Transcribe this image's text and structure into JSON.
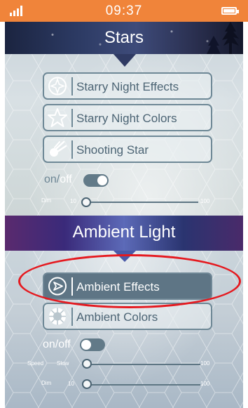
{
  "status_bar": {
    "time": "09:37"
  },
  "stars": {
    "title": "Stars",
    "buttons": [
      {
        "label": "Starry Night Effects",
        "icon": "compass-star-icon"
      },
      {
        "label": "Starry Night Colors",
        "icon": "star-outline-icon"
      },
      {
        "label": "Shooting Star",
        "icon": "shooting-star-icon"
      }
    ],
    "toggle": {
      "on": "on",
      "slash": "/",
      "off": "off",
      "state": true
    },
    "dim": {
      "label": "Dim",
      "min": "10",
      "max": "100",
      "value": 10
    }
  },
  "ambient": {
    "title": "Ambient Light",
    "buttons": [
      {
        "label": "Ambient Effects",
        "icon": "play-circle-icon",
        "active": true
      },
      {
        "label": "Ambient Colors",
        "icon": "color-wheel-icon"
      }
    ],
    "toggle": {
      "label": "on/off",
      "state": false
    },
    "speed": {
      "label": "Speed",
      "min": "Slow",
      "max": "100",
      "value": 0
    },
    "dim": {
      "label": "Dim",
      "min": "10",
      "max": "100",
      "value": 10
    }
  },
  "colors": {
    "status_bar": "#f0843a",
    "highlight": "#e5191f",
    "button_border": "#6e8896",
    "active_button": "#5e7585"
  }
}
